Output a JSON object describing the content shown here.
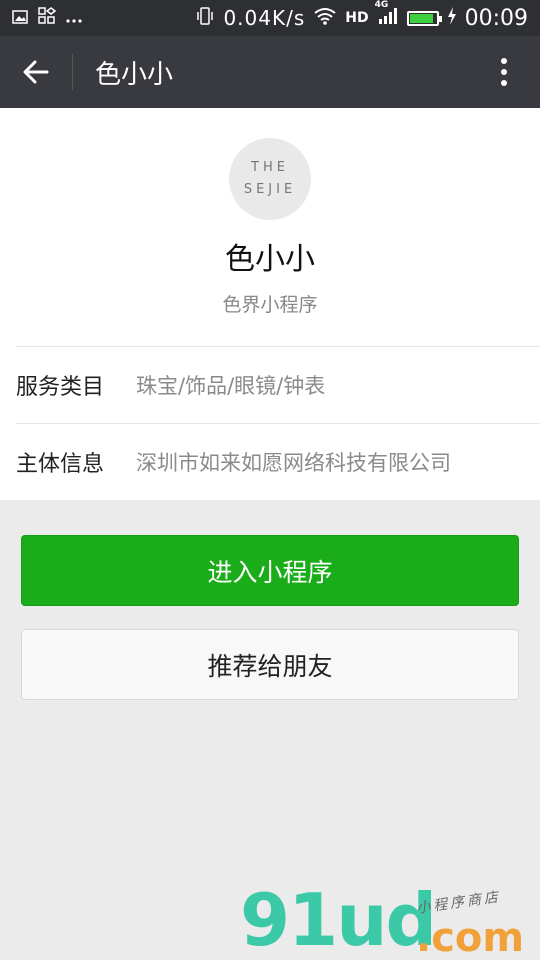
{
  "status_bar": {
    "speed": "0.04K/s",
    "network": "HD",
    "network_gen": "4G",
    "battery_level": 0.9,
    "time": "00:09"
  },
  "nav": {
    "title": "色小小"
  },
  "profile": {
    "avatar_line1": "THE",
    "avatar_line2": "SEJIE",
    "name": "色小小",
    "subtitle": "色界小程序"
  },
  "info": [
    {
      "label": "服务类目",
      "value": "珠宝/饰品/眼镜/钟表"
    },
    {
      "label": "主体信息",
      "value": "深圳市如来如愿网络科技有限公司"
    }
  ],
  "actions": {
    "enter_label": "进入小程序",
    "recommend_label": "推荐给朋友"
  },
  "watermark": {
    "brand": "91ud",
    "domain": ".com",
    "tagline": "小程序商店"
  },
  "colors": {
    "primary": "#1aad19",
    "nav_bg": "#393a3f",
    "status_bg": "#2e2f33",
    "page_bg": "#ebebeb"
  }
}
